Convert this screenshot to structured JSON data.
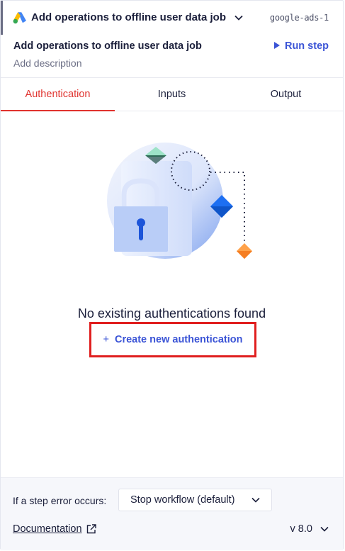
{
  "header": {
    "step_name": "Add operations to offline user data job",
    "step_id": "google-ads-1",
    "title": "Add operations to offline user data job",
    "run_label": "Run step",
    "description_placeholder": "Add description",
    "app_icon": "google-ads-logo-icon"
  },
  "tabs": [
    {
      "label": "Authentication",
      "active": true
    },
    {
      "label": "Inputs",
      "active": false
    },
    {
      "label": "Output",
      "active": false
    }
  ],
  "empty_state": {
    "title": "No existing authentications found",
    "create_label": "Create new authentication",
    "illustration_icon": "lock-illustration-icon"
  },
  "footer": {
    "error_label": "If a step error occurs:",
    "error_option": "Stop workflow (default)",
    "docs_label": "Documentation",
    "version": "v 8.0"
  },
  "colors": {
    "accent_blue": "#3b54d6",
    "active_tab_red": "#e0322e",
    "highlight_box": "#e01f1f",
    "footer_bg": "#f6f7fb"
  }
}
